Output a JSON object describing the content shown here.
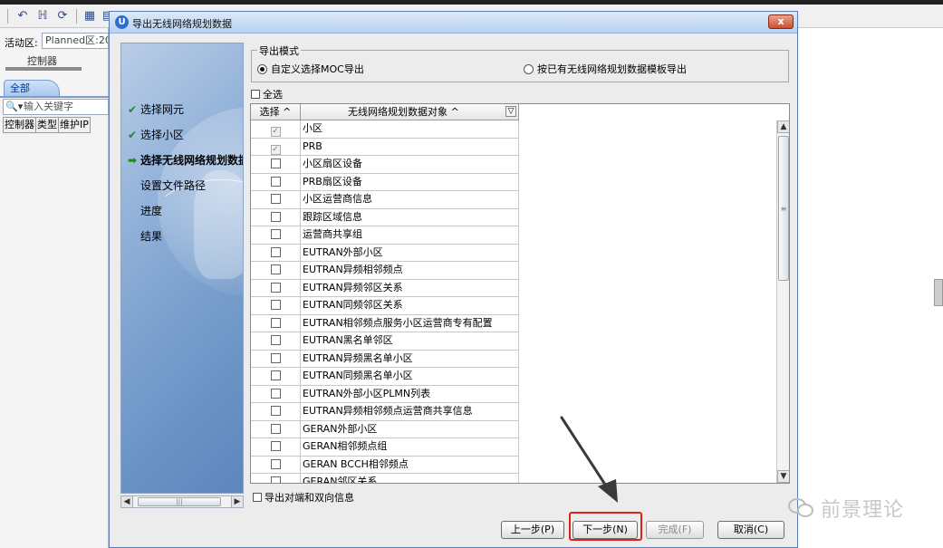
{
  "background": {
    "active_area_label": "活动区:",
    "active_area_value": "Planned区:20",
    "controller_label": "控制器",
    "all_tab": "全部",
    "keyword_placeholder": "输入关键字",
    "columns": [
      "控制器",
      "类型",
      "维护IP"
    ],
    "toolbar_icons": [
      "undo-icon",
      "hierarchy-icon",
      "refresh-icon",
      "grid-icon",
      "table-icon",
      "print-icon"
    ]
  },
  "dialog": {
    "title": "导出无线网络规划数据",
    "close_label": "x",
    "wizard_steps": [
      {
        "label": "选择网元",
        "state": "done"
      },
      {
        "label": "选择小区",
        "state": "done"
      },
      {
        "label": "选择无线网络规划数据",
        "state": "current"
      },
      {
        "label": "设置文件路径",
        "state": "pending"
      },
      {
        "label": "进度",
        "state": "pending"
      },
      {
        "label": "结果",
        "state": "pending"
      }
    ],
    "export_mode": {
      "title": "导出模式",
      "option_custom": "自定义选择MOC导出",
      "option_template": "按已有无线网络规划数据模板导出",
      "selected": "custom"
    },
    "select_all_label": "全选",
    "table": {
      "col_select": "选择 ^",
      "col_object": "无线网络规划数据对象 ^",
      "filter_icon": "filter-icon",
      "rows": [
        {
          "name": "小区",
          "checked": true,
          "disabled": true
        },
        {
          "name": "PRB",
          "checked": true,
          "disabled": true
        },
        {
          "name": "小区扇区设备",
          "checked": false,
          "disabled": false
        },
        {
          "name": "PRB扇区设备",
          "checked": false,
          "disabled": false
        },
        {
          "name": "小区运营商信息",
          "checked": false,
          "disabled": false
        },
        {
          "name": "跟踪区域信息",
          "checked": false,
          "disabled": false
        },
        {
          "name": "运营商共享组",
          "checked": false,
          "disabled": false
        },
        {
          "name": "EUTRAN外部小区",
          "checked": false,
          "disabled": false
        },
        {
          "name": "EUTRAN异频相邻频点",
          "checked": false,
          "disabled": false
        },
        {
          "name": "EUTRAN异频邻区关系",
          "checked": false,
          "disabled": false
        },
        {
          "name": "EUTRAN同频邻区关系",
          "checked": false,
          "disabled": false
        },
        {
          "name": "EUTRAN相邻频点服务小区运营商专有配置",
          "checked": false,
          "disabled": false
        },
        {
          "name": "EUTRAN黑名单邻区",
          "checked": false,
          "disabled": false
        },
        {
          "name": "EUTRAN异频黑名单小区",
          "checked": false,
          "disabled": false
        },
        {
          "name": "EUTRAN同频黑名单小区",
          "checked": false,
          "disabled": false
        },
        {
          "name": "EUTRAN外部小区PLMN列表",
          "checked": false,
          "disabled": false
        },
        {
          "name": "EUTRAN异频相邻频点运营商共享信息",
          "checked": false,
          "disabled": false
        },
        {
          "name": "GERAN外部小区",
          "checked": false,
          "disabled": false
        },
        {
          "name": "GERAN相邻频点组",
          "checked": false,
          "disabled": false
        },
        {
          "name": "GERAN BCCH相邻频点",
          "checked": false,
          "disabled": false
        },
        {
          "name": "GERAN邻区关系",
          "checked": false,
          "disabled": false
        }
      ]
    },
    "export_both_label": "导出对端和双向信息",
    "buttons": {
      "prev": "上一步(P)",
      "next": "下一步(N)",
      "finish": "完成(F)",
      "cancel": "取消(C)"
    }
  },
  "watermark": {
    "text": "前景理论"
  },
  "colors": {
    "highlight": "#e0201a",
    "check_green": "#1d8a1d",
    "title_bar": "#b9d1ef"
  }
}
